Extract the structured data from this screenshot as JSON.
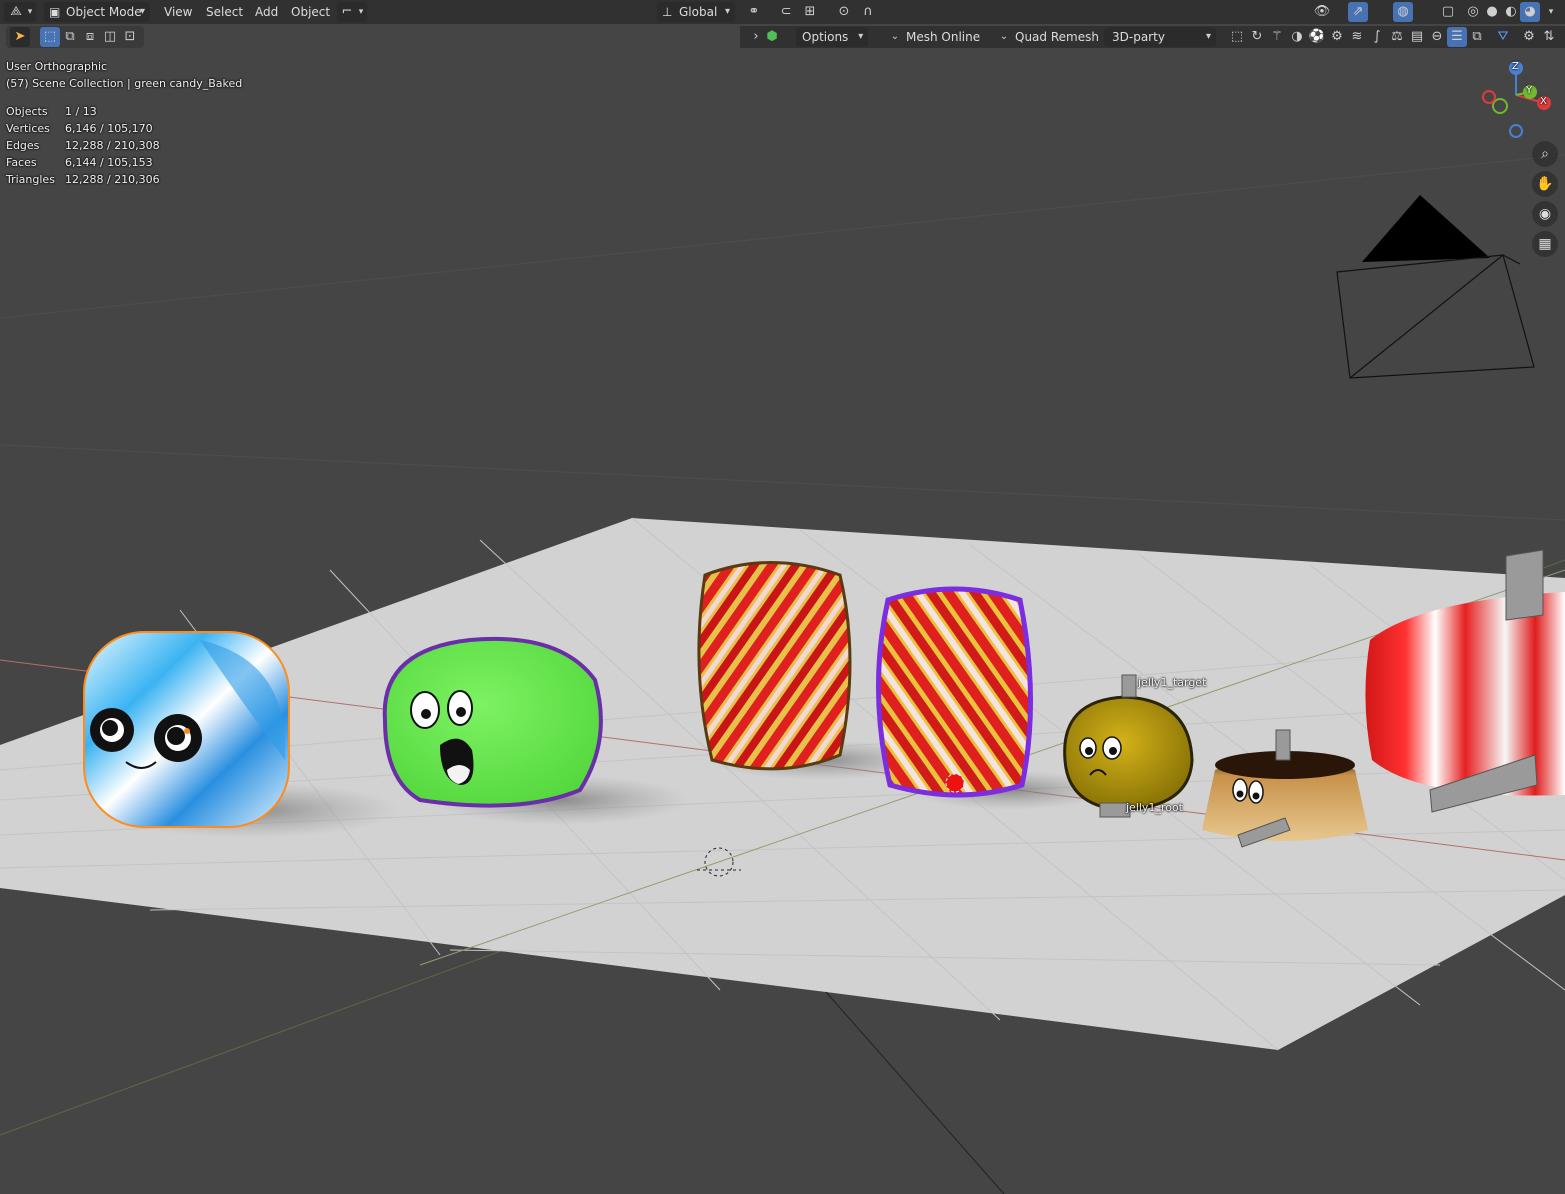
{
  "header": {
    "mode": "Object Mode",
    "menus": [
      "View",
      "Select",
      "Add",
      "Object"
    ],
    "transform_orientation": "Global"
  },
  "tool_header": {
    "options": "Options",
    "addons": [
      "Mesh Online",
      "Quad Remesh"
    ],
    "dropdown": "3D-party"
  },
  "overlay": {
    "view_name": "User Orthographic",
    "collection_line": "(57) Scene Collection | green candy_Baked",
    "stats": [
      {
        "label": "Objects",
        "value": "1 / 13"
      },
      {
        "label": "Vertices",
        "value": "6,146 / 105,170"
      },
      {
        "label": "Edges",
        "value": "12,288 / 210,308"
      },
      {
        "label": "Faces",
        "value": "6,144 / 105,153"
      },
      {
        "label": "Triangles",
        "value": "12,288 / 210,306"
      }
    ]
  },
  "gizmo": {
    "x": "X",
    "y": "Y",
    "z": "Z"
  },
  "scene_labels": {
    "target": "jelly1_target",
    "root": "jelly1_root"
  },
  "colors": {
    "viewport_bg": "#454545",
    "floor": "#d4d4d4",
    "header_bg": "#303030",
    "active_blue": "#4772b3",
    "selection_orange": "#ff8c1a"
  }
}
